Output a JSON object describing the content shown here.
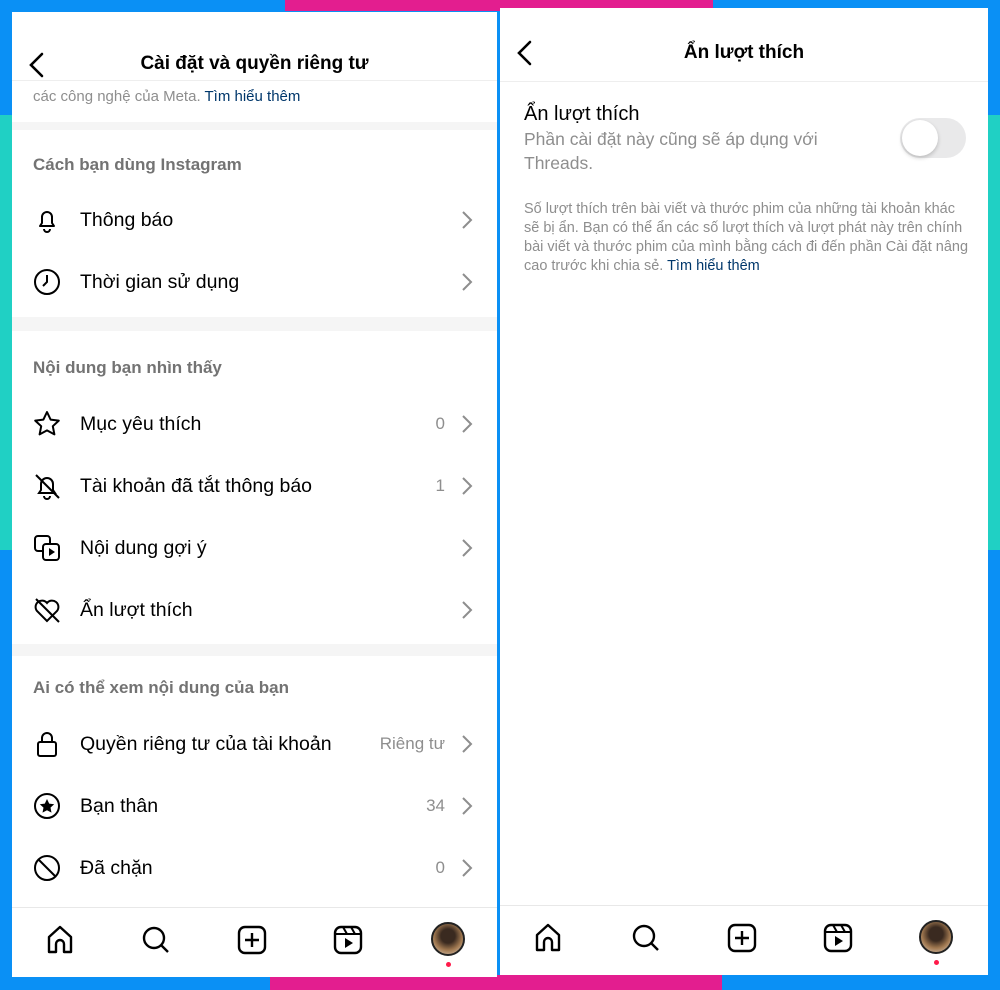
{
  "colors": {
    "frame": "#0a90f5",
    "accent_pink": "#e31e8f",
    "accent_teal": "#20d0c4",
    "link": "#00376b"
  },
  "left": {
    "title": "Cài đặt và quyền riêng tư",
    "intro_text": "các công nghệ của Meta.",
    "intro_link": "Tìm hiểu thêm",
    "sections": [
      {
        "header": "Cách bạn dùng Instagram",
        "items": [
          {
            "icon": "bell-icon",
            "label": "Thông báo",
            "value": ""
          },
          {
            "icon": "clock-icon",
            "label": "Thời gian sử dụng",
            "value": ""
          }
        ]
      },
      {
        "header": "Nội dung bạn nhìn thấy",
        "items": [
          {
            "icon": "star-icon",
            "label": "Mục yêu thích",
            "value": "0"
          },
          {
            "icon": "bell-off-icon",
            "label": "Tài khoản đã tắt thông báo",
            "value": "1"
          },
          {
            "icon": "suggested-content-icon",
            "label": "Nội dung gợi ý",
            "value": ""
          },
          {
            "icon": "heart-off-icon",
            "label": "Ẩn lượt thích",
            "value": ""
          }
        ]
      },
      {
        "header": "Ai có thể xem nội dung của bạn",
        "items": [
          {
            "icon": "lock-icon",
            "label": "Quyền riêng tư của tài khoản",
            "value": "Riêng tư"
          },
          {
            "icon": "close-friends-star-icon",
            "label": "Bạn thân",
            "value": "34"
          },
          {
            "icon": "block-icon",
            "label": "Đã chặn",
            "value": "0"
          }
        ]
      }
    ]
  },
  "right": {
    "title": "Ẩn lượt thích",
    "setting_title": "Ẩn lượt thích",
    "setting_subtitle": "Phần cài đặt này cũng sẽ áp dụng với Threads.",
    "toggle_on": false,
    "description": "Số lượt thích trên bài viết và thước phim của những tài khoản khác sẽ bị ẩn. Bạn có thể ẩn các số lượt thích và lượt phát này trên chính bài viết và thước phim của mình bằng cách đi đến phần Cài đặt nâng cao trước khi chia sẻ.",
    "description_link": "Tìm hiểu thêm"
  },
  "nav": [
    "home-icon",
    "search-icon",
    "create-icon",
    "reels-icon",
    "profile-avatar"
  ]
}
